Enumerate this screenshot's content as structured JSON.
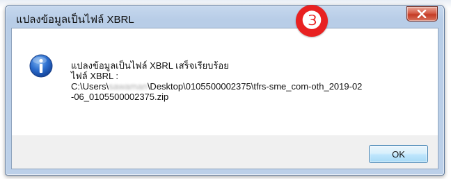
{
  "window": {
    "title": "แปลงข้อมูลเป็นไฟล์ XBRL",
    "close_icon": "close-icon",
    "close_color": "#c43b25"
  },
  "step_badge": {
    "label": "❸",
    "color": "#e82121"
  },
  "message": {
    "icon": "info-icon",
    "line1": "แปลงข้อมูลเป็นไฟล์ XBRL เสร็จเรียบร้อย",
    "line2": "ไฟล์ XBRL :",
    "path_prefix": "C:\\Users\\",
    "path_user_blurred": "sawaman",
    "path_suffix": "\\Desktop\\0105500002375\\tfrs-sme_com-oth_2019-02",
    "line4": "-06_0105500002375.zip"
  },
  "buttons": {
    "ok_label": "OK"
  }
}
